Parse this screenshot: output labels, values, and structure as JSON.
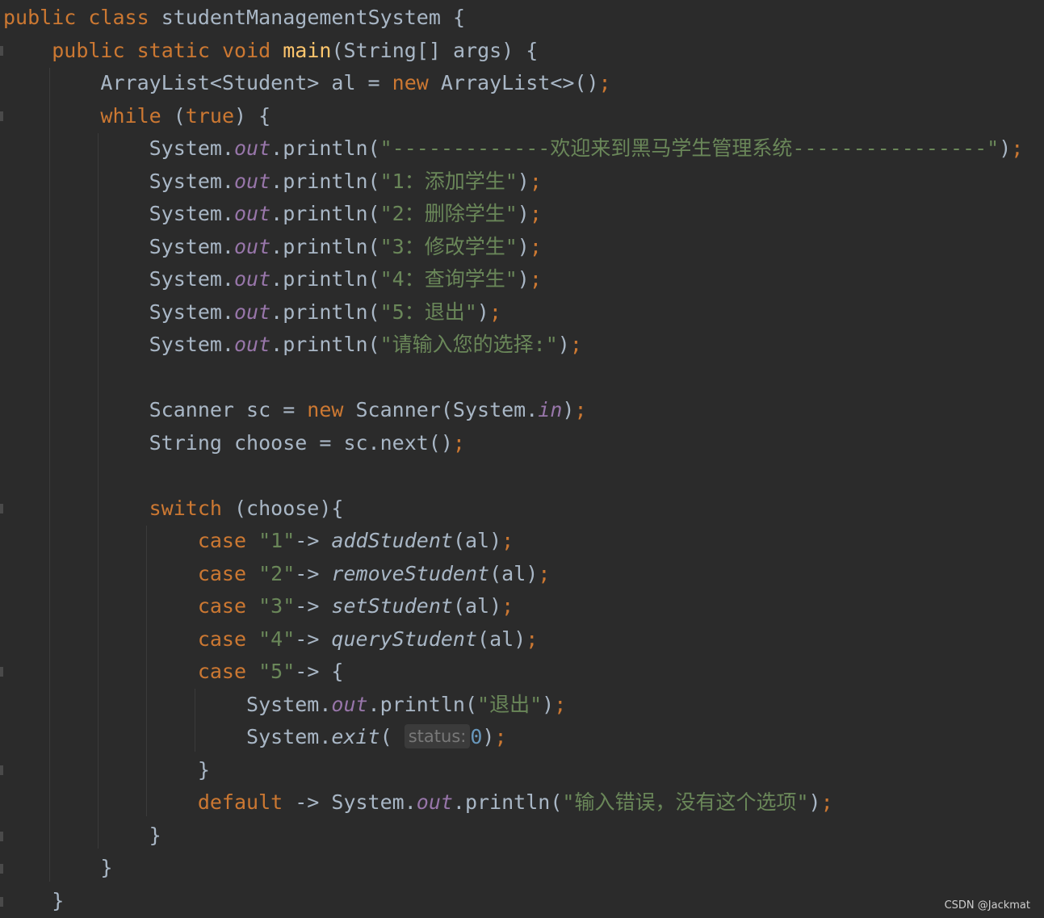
{
  "editor": {
    "code": {
      "kw_public": "public",
      "kw_class": "class",
      "class_name": "studentManagementSystem",
      "open_brace": "{",
      "close_brace": "}",
      "kw_static": "static",
      "kw_void": "void",
      "method_main": "main",
      "main_params": "(String[] args) ",
      "arraylist_decl": "ArrayList<Student> al = ",
      "kw_new": "new",
      "arraylist_init": " ArrayList<>()",
      "kw_while": "while",
      "paren_open": " (",
      "kw_true": "true",
      "paren_close_brace": ") {",
      "system": "System.",
      "out": "out",
      "println_open": ".println(",
      "str_welcome": "\"-------------欢迎来到黑马学生管理系统----------------\"",
      "str_opt1": "\"1：添加学生\"",
      "str_opt2": "\"2：删除学生\"",
      "str_opt3": "\"3：修改学生\"",
      "str_opt4": "\"4：查询学生\"",
      "str_opt5": "\"5：退出\"",
      "str_prompt": "\"请输入您的选择:\"",
      "close_paren": ")",
      "semicolon": ";",
      "scanner_decl": "Scanner sc = ",
      "scanner_init": " Scanner(System.",
      "field_in": "in",
      "choose_decl": "String choose = sc.next()",
      "kw_switch": "switch",
      "switch_expr": " (choose){",
      "kw_case": "case",
      "case1_val": "\"1\"",
      "case2_val": "\"2\"",
      "case3_val": "\"3\"",
      "case4_val": "\"4\"",
      "case5_val": "\"5\"",
      "arrow": "-> ",
      "call_add": "addStudent",
      "call_remove": "removeStudent",
      "call_set": "setStudent",
      "call_query": "queryStudent",
      "call_args": "(al)",
      "brace_open_inline": "{",
      "str_exit": "\"退出\"",
      "exit_method": "exit",
      "paren_open_only": "(",
      "hint_status": "status:",
      "num_zero": "0",
      "kw_default": "default",
      "default_arrow": " -> System.",
      "str_error": "\"输入错误，没有这个选项\""
    }
  },
  "watermark": "CSDN @Jackmat"
}
